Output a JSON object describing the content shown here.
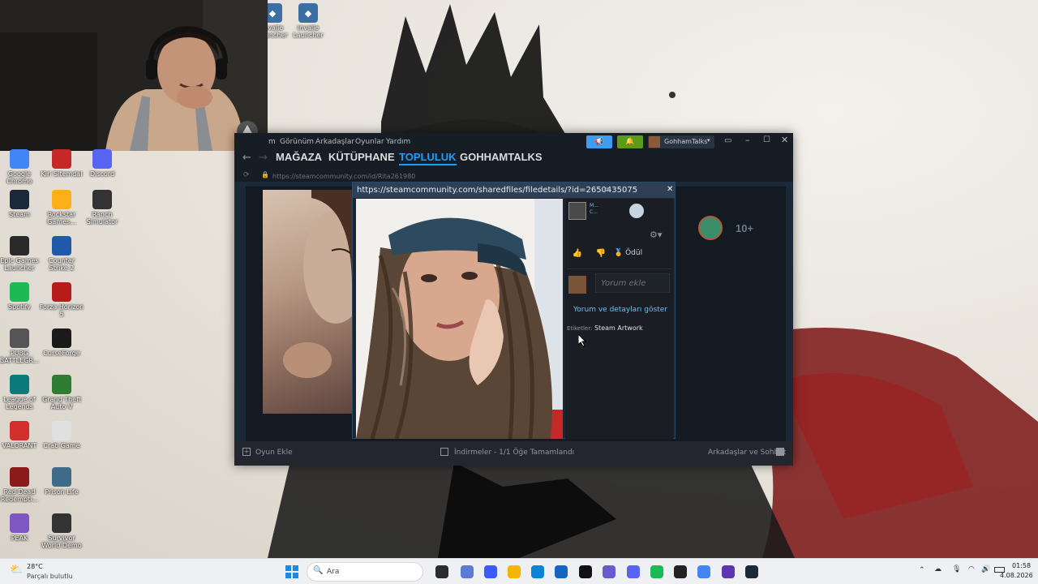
{
  "desktop": {
    "top_icons": [
      {
        "label": "Invalie Launcher"
      },
      {
        "label": "Invalie Launcher"
      }
    ],
    "icons": [
      {
        "label": "Google Chrome",
        "color": "#4285f4",
        "icon": "chrome-icon"
      },
      {
        "label": "Kiri Sitemdal",
        "color": "#c62828",
        "icon": "app-icon"
      },
      {
        "label": "Discord",
        "color": "#5865f2",
        "icon": "discord-icon"
      },
      {
        "label": "Steam",
        "color": "#1b2838",
        "icon": "steam-icon"
      },
      {
        "label": "Rockstar Games...",
        "color": "#fcaf17",
        "icon": "rockstar-icon"
      },
      {
        "label": "Ranch Simulator",
        "color": "#333333",
        "icon": "ranch-icon"
      },
      {
        "label": "Epic Games Launcher",
        "color": "#2a2a2a",
        "icon": "epic-icon"
      },
      {
        "label": "Counter Strike 2",
        "color": "#1e5aa8",
        "icon": "cs2-icon"
      },
      {
        "label": "Spotify",
        "color": "#1db954",
        "icon": "spotify-icon"
      },
      {
        "label": "Forza Horizon 5",
        "color": "#b71c1c",
        "icon": "forza-icon"
      },
      {
        "label": "PUBG BATTLEGR...",
        "color": "#555555",
        "icon": "pubg-icon"
      },
      {
        "label": "CurseForge",
        "color": "#1a1a1a",
        "icon": "curseforge-icon"
      },
      {
        "label": "League of Legends",
        "color": "#0a7a7a",
        "icon": "lol-icon"
      },
      {
        "label": "Grand Theft Auto V",
        "color": "#2e7d32",
        "icon": "gta-icon"
      },
      {
        "label": "VALORANT",
        "color": "#d32f2f",
        "icon": "valorant-icon"
      },
      {
        "label": "Crab Game",
        "color": "#e0e0e0",
        "icon": "crab-icon"
      },
      {
        "label": "Red Dead Redempti...",
        "color": "#8b1a1a",
        "icon": "rdr-icon"
      },
      {
        "label": "Prison Life",
        "color": "#3e6b8a",
        "icon": "prison-icon"
      },
      {
        "label": "PEAK",
        "color": "#7e57c2",
        "icon": "peak-icon"
      },
      {
        "label": "Survivor World Demo",
        "color": "#333333",
        "icon": "survivor-icon"
      }
    ]
  },
  "steam": {
    "menu": [
      "m",
      "Görünüm",
      "Arkadaşlar",
      "Oyunlar",
      "Yardım"
    ],
    "user": "GohhamTalks",
    "tabs": [
      "MAĞAZA",
      "KÜTÜPHANE",
      "TOPLULUK",
      "GOHHAMTALKS"
    ],
    "active_tab": "TOPLULUK",
    "url": "https://steamcommunity.com/id/Rita261980",
    "bottom": {
      "add_game": "Oyun Ekle",
      "downloads": "İndirmeler - 1/1 Öğe Tamamlandı",
      "friends": "Arkadaşlar ve Sohbet"
    },
    "badge_level": "10+",
    "accent": "#1a9fff"
  },
  "modal": {
    "url": "https://steamcommunity.com/sharedfiles/filedetails/?id=2650435075",
    "author_short": "M... C...",
    "award_label": "Ödül",
    "comment_placeholder": "Yorum ekle",
    "details_link": "Yorum ve detayları göster",
    "tags_label": "Etiketler:",
    "tags_value": "Steam Artwork"
  },
  "taskbar": {
    "weather_temp": "28°C",
    "weather_desc": "Parçalı bulutlu",
    "search_placeholder": "Ara",
    "time": "01:58",
    "date": "4.08.2026"
  }
}
